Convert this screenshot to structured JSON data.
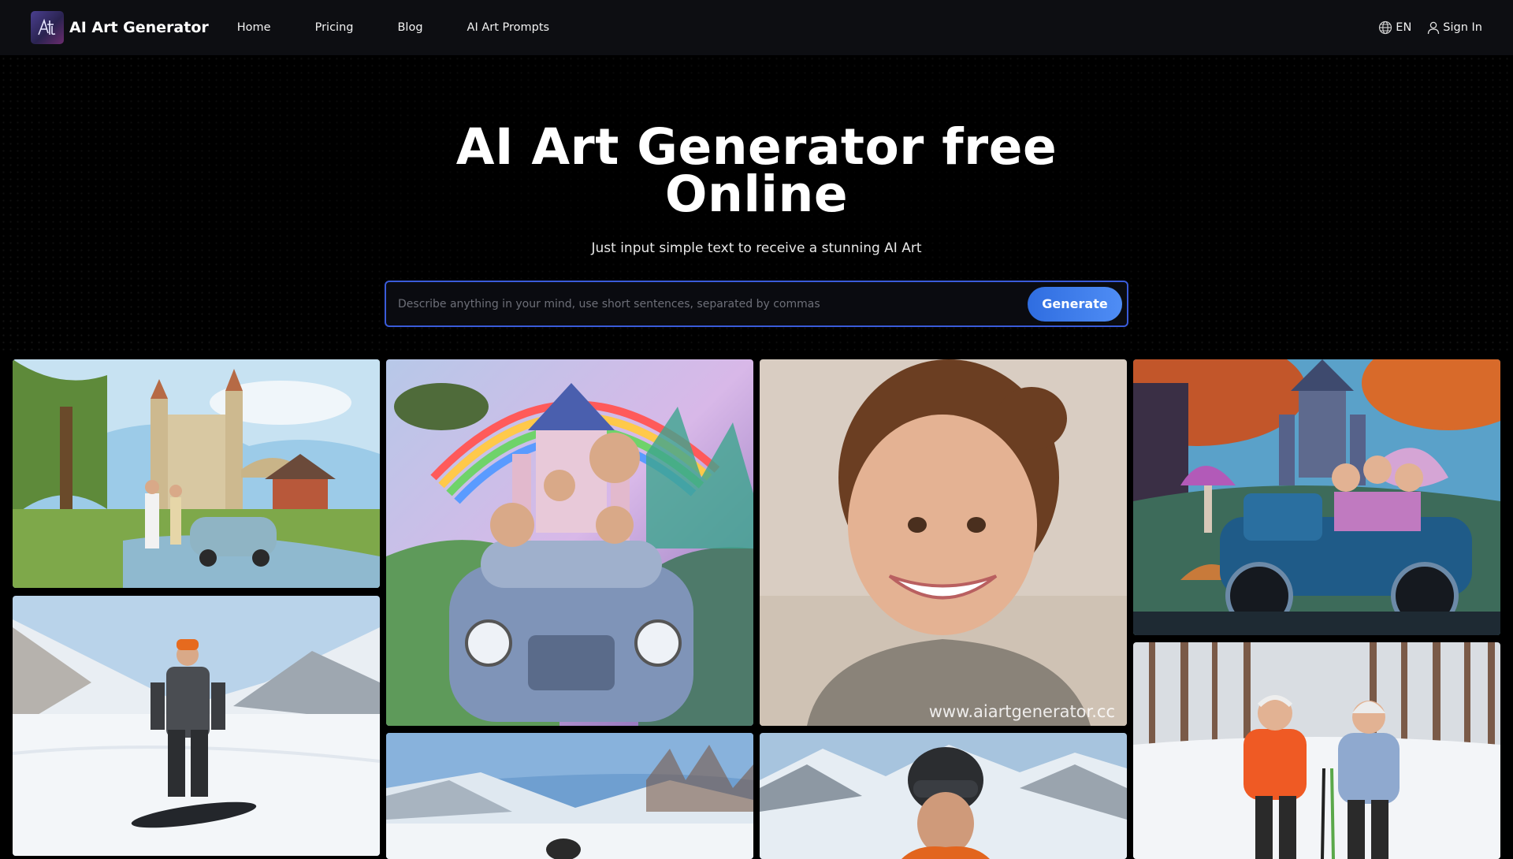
{
  "header": {
    "brand_name": "AI Art Generator",
    "nav": [
      "Home",
      "Pricing",
      "Blog",
      "AI Art Prompts"
    ],
    "language": "EN",
    "sign_in": "Sign In"
  },
  "hero": {
    "title_line1": "AI Art Generator free",
    "title_line2": "Online",
    "subtitle": "Just input simple text to receive a stunning AI Art",
    "prompt_placeholder": "Describe anything in your mind, use short sentences, separated by commas",
    "generate_label": "Generate"
  },
  "gallery": {
    "watermark": "www.aiartgenerator.cc",
    "items": [
      "family-castle-car-artwork",
      "family-rainbow-castle-car-artwork",
      "smiling-girl-portrait",
      "fairy-family-vintage-car-artwork",
      "snowboarder-mountain-photo",
      "skier-snowy-slope-photo",
      "skier-helmet-mountain-photo",
      "elderly-couple-skiing-forest-photo"
    ]
  },
  "colors": {
    "background": "#000000",
    "navbar": "#0d0e12",
    "accent": "#3a5bd9",
    "button_start": "#2f6de0",
    "button_end": "#4f8df5"
  }
}
